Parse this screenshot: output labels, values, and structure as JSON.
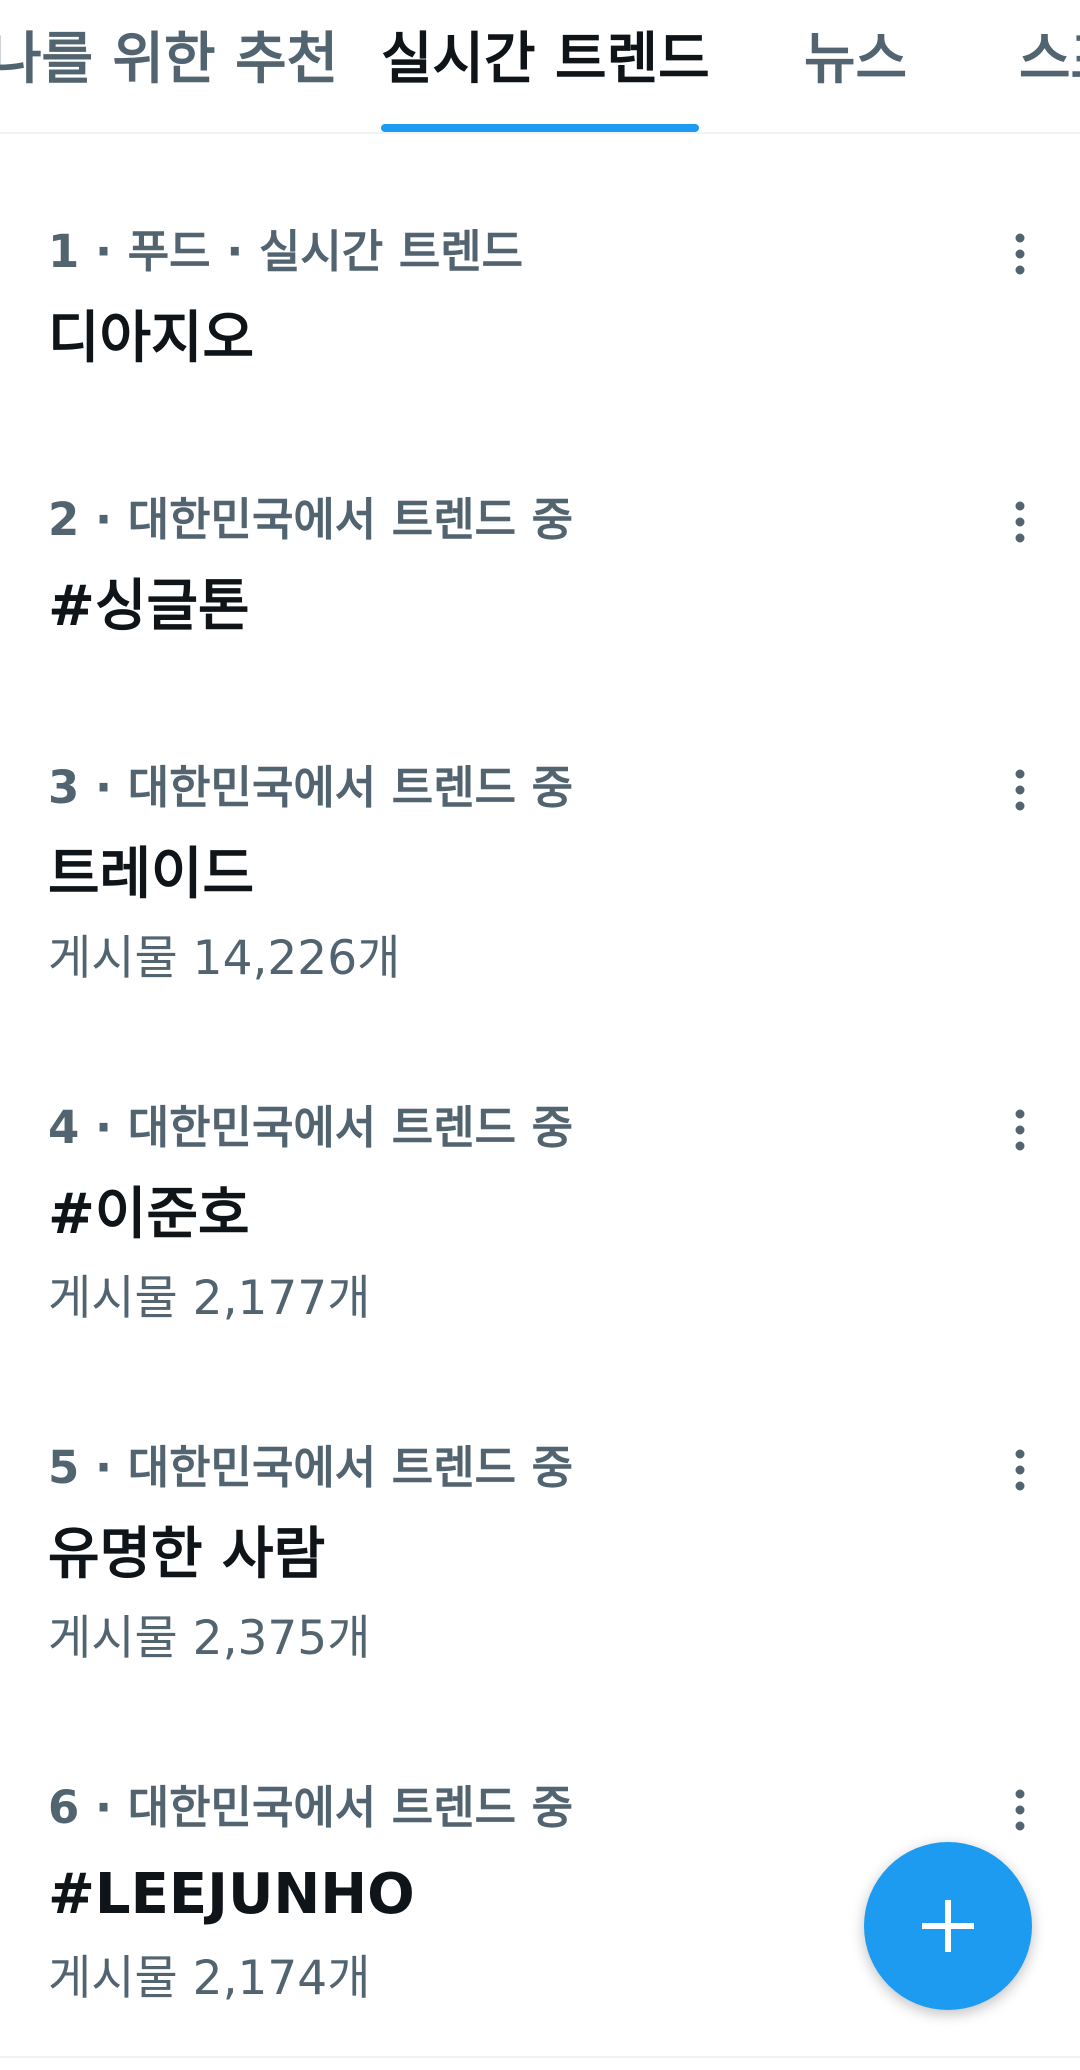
{
  "tabs": [
    {
      "label": "나를 위한 추천",
      "active": false
    },
    {
      "label": "실시간 트렌드",
      "active": true
    },
    {
      "label": "뉴스",
      "active": false
    },
    {
      "label": "스포츠",
      "active": false
    }
  ],
  "trends": [
    {
      "context": "1 · 푸드 · 실시간 트렌드",
      "name": "디아지오",
      "count": ""
    },
    {
      "context": "2 · 대한민국에서 트렌드 중",
      "name": "#싱글톤",
      "count": ""
    },
    {
      "context": "3 · 대한민국에서 트렌드 중",
      "name": "트레이드",
      "count": "게시물 14,226개"
    },
    {
      "context": "4 · 대한민국에서 트렌드 중",
      "name": "#이준호",
      "count": "게시물 2,177개"
    },
    {
      "context": "5 · 대한민국에서 트렌드 중",
      "name": "유명한 사람",
      "count": "게시물 2,375개"
    },
    {
      "context": "6 · 대한민국에서 트렌드 중",
      "name": "#LEEJUNHO",
      "count": "게시물 2,174개"
    }
  ],
  "icons": {
    "more": "more-vertical-icon",
    "compose": "plus-icon"
  },
  "colors": {
    "accent": "#1d9bf0",
    "primary_text": "#0f1419",
    "secondary_text": "#536471",
    "divider": "#eff3f4"
  }
}
